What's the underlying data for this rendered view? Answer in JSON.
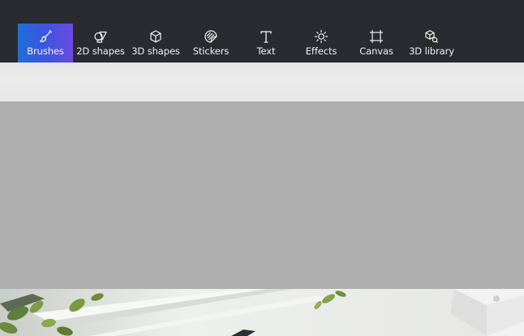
{
  "toolbar": {
    "items": [
      {
        "label": "Brushes",
        "icon": "brush-icon",
        "active": true
      },
      {
        "label": "2D shapes",
        "icon": "2d-shapes-icon",
        "active": false
      },
      {
        "label": "3D shapes",
        "icon": "3d-cube-icon",
        "active": false
      },
      {
        "label": "Stickers",
        "icon": "sticker-icon",
        "active": false
      },
      {
        "label": "Text",
        "icon": "text-icon",
        "active": false
      },
      {
        "label": "Effects",
        "icon": "sun-effects-icon",
        "active": false
      },
      {
        "label": "Canvas",
        "icon": "canvas-crop-icon",
        "active": false
      },
      {
        "label": "3D library",
        "icon": "3d-library-icon",
        "active": false
      }
    ]
  },
  "colors": {
    "toolbar_bg": "#2a2b30",
    "active_gradient_start": "#1f6fd8",
    "active_gradient_end": "#6a4be0",
    "subbar_bg": "#e9e9e9",
    "canvas_area_bg": "#aeafae",
    "label_color": "#f1f1f1"
  }
}
